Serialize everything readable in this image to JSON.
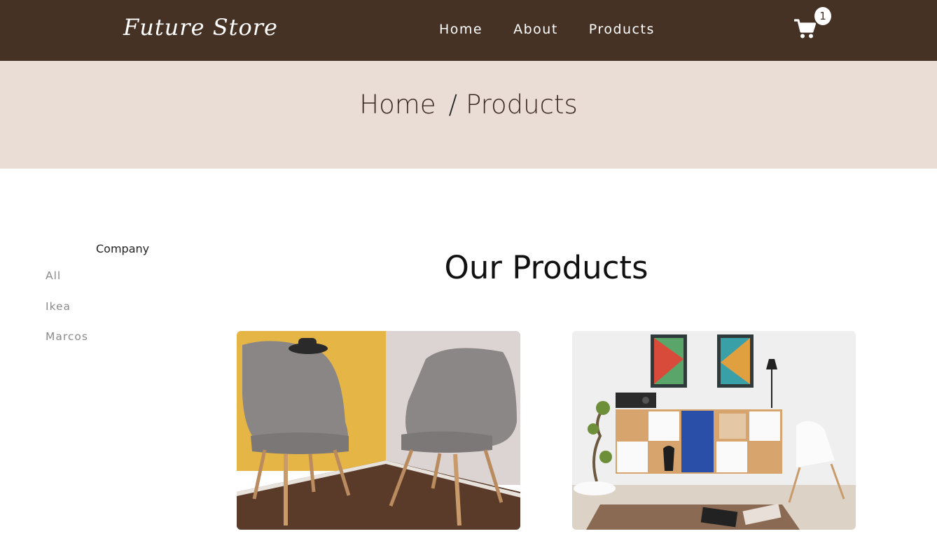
{
  "navbar": {
    "brand": "Future Store",
    "links": [
      "Home",
      "About",
      "Products"
    ],
    "cart_count": "1"
  },
  "hero": {
    "breadcrumb_home": "Home",
    "breadcrumb_separator": "/",
    "breadcrumb_current": "Products"
  },
  "sidebar": {
    "heading": "Company",
    "filters": [
      "All",
      "Ikea",
      "Marcos"
    ]
  },
  "main": {
    "title": "Our Products",
    "products": [
      {
        "image": "two-grey-armchairs-photo"
      },
      {
        "image": "living-room-cabinet-photo"
      }
    ]
  },
  "colors": {
    "navbar": "#463125",
    "hero": "#eaddd5",
    "filter_text": "#8a8a8a"
  }
}
